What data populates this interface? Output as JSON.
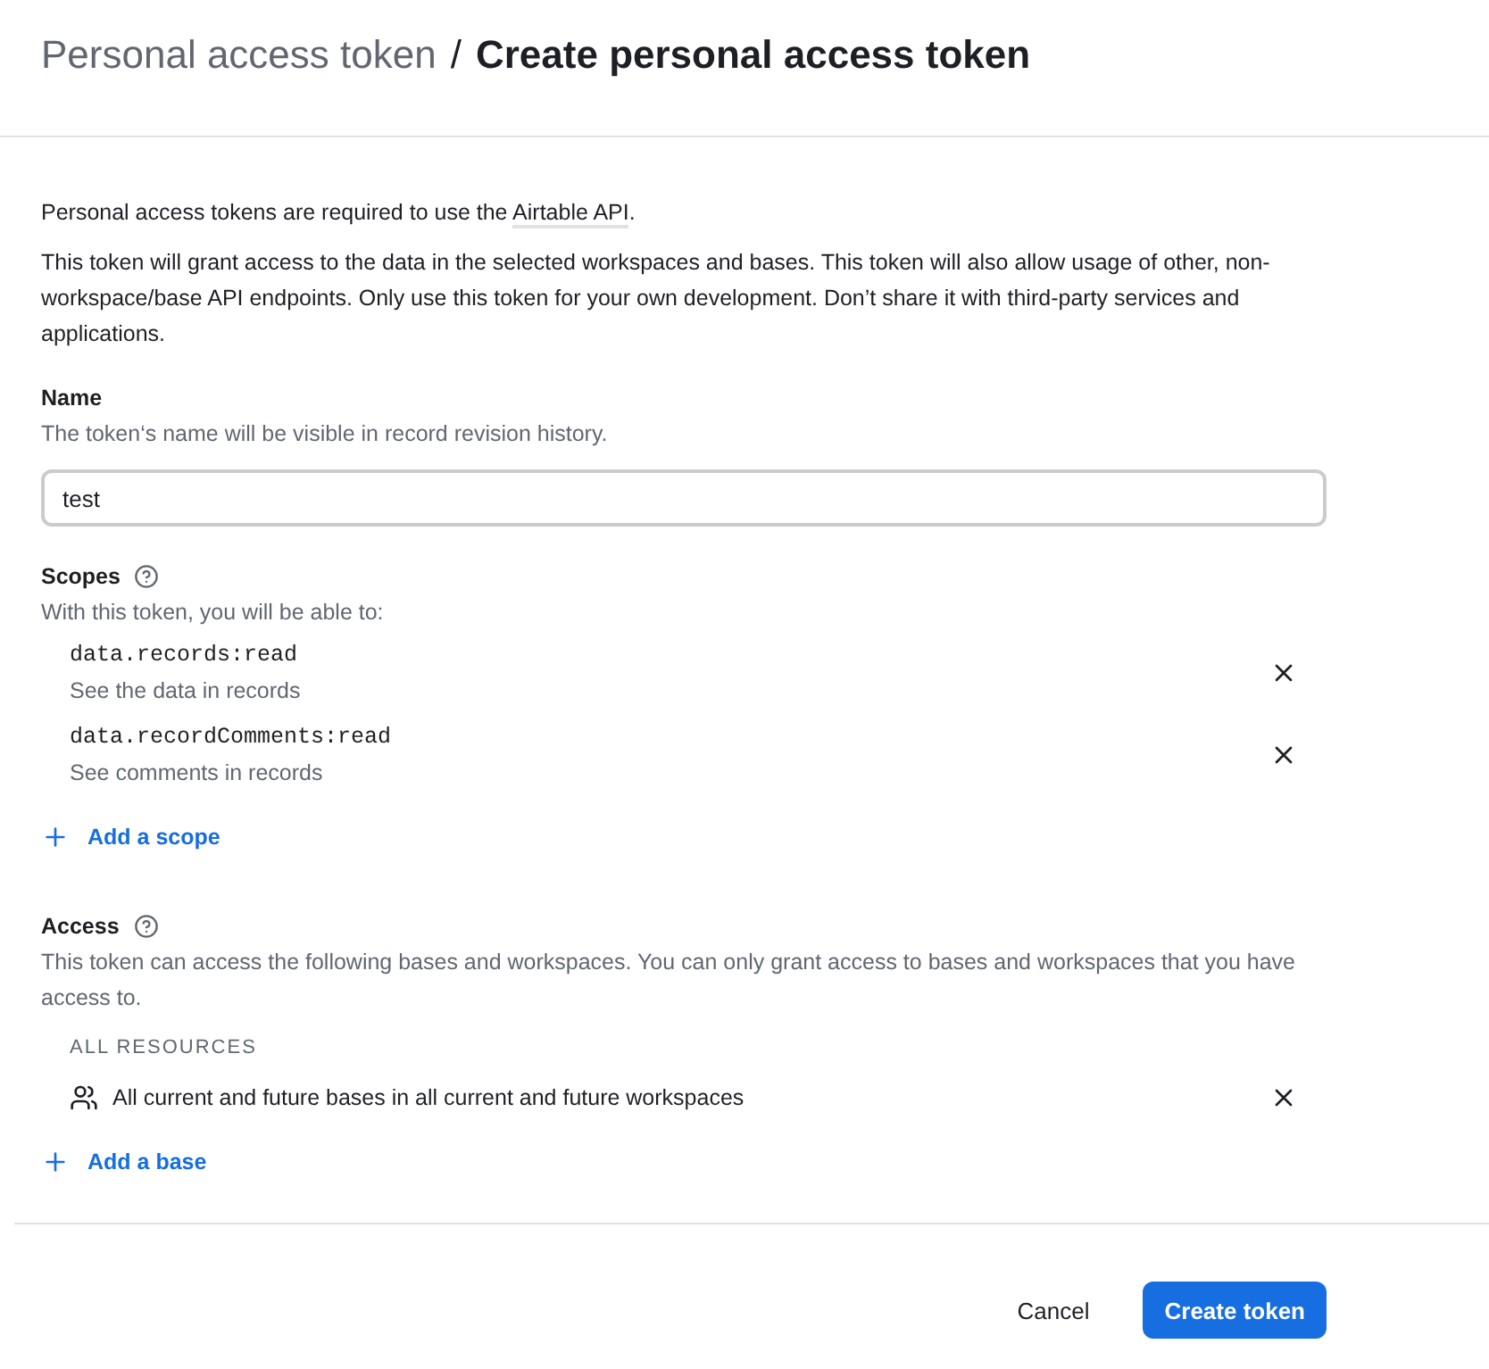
{
  "header": {
    "parent": "Personal access token",
    "separator": "/",
    "title": "Create personal access token"
  },
  "intro": {
    "before": "Personal access tokens are required to use the ",
    "link": "Airtable API",
    "after": "."
  },
  "description": "This token will grant access to the data in the selected workspaces and bases. This token will also allow usage of other, non-workspace/base API endpoints. Only use this token for your own development. Don’t share it with third-party services and applications.",
  "name_field": {
    "label": "Name",
    "hint": "The token‘s name will be visible in record revision history.",
    "value": "test"
  },
  "scopes": {
    "label": "Scopes",
    "hint": "With this token, you will be able to:",
    "items": [
      {
        "name": "data.records:read",
        "description": "See the data in records"
      },
      {
        "name": "data.recordComments:read",
        "description": "See comments in records"
      }
    ],
    "add": "Add a scope"
  },
  "access": {
    "label": "Access",
    "hint": "This token can access the following bases and workspaces. You can only grant access to bases and workspaces that you have access to.",
    "group": "ALL RESOURCES",
    "items": [
      {
        "label": "All current and future bases in all current and future workspaces"
      }
    ],
    "add": "Add a base"
  },
  "buttons": {
    "cancel": "Cancel",
    "submit": "Create token"
  }
}
